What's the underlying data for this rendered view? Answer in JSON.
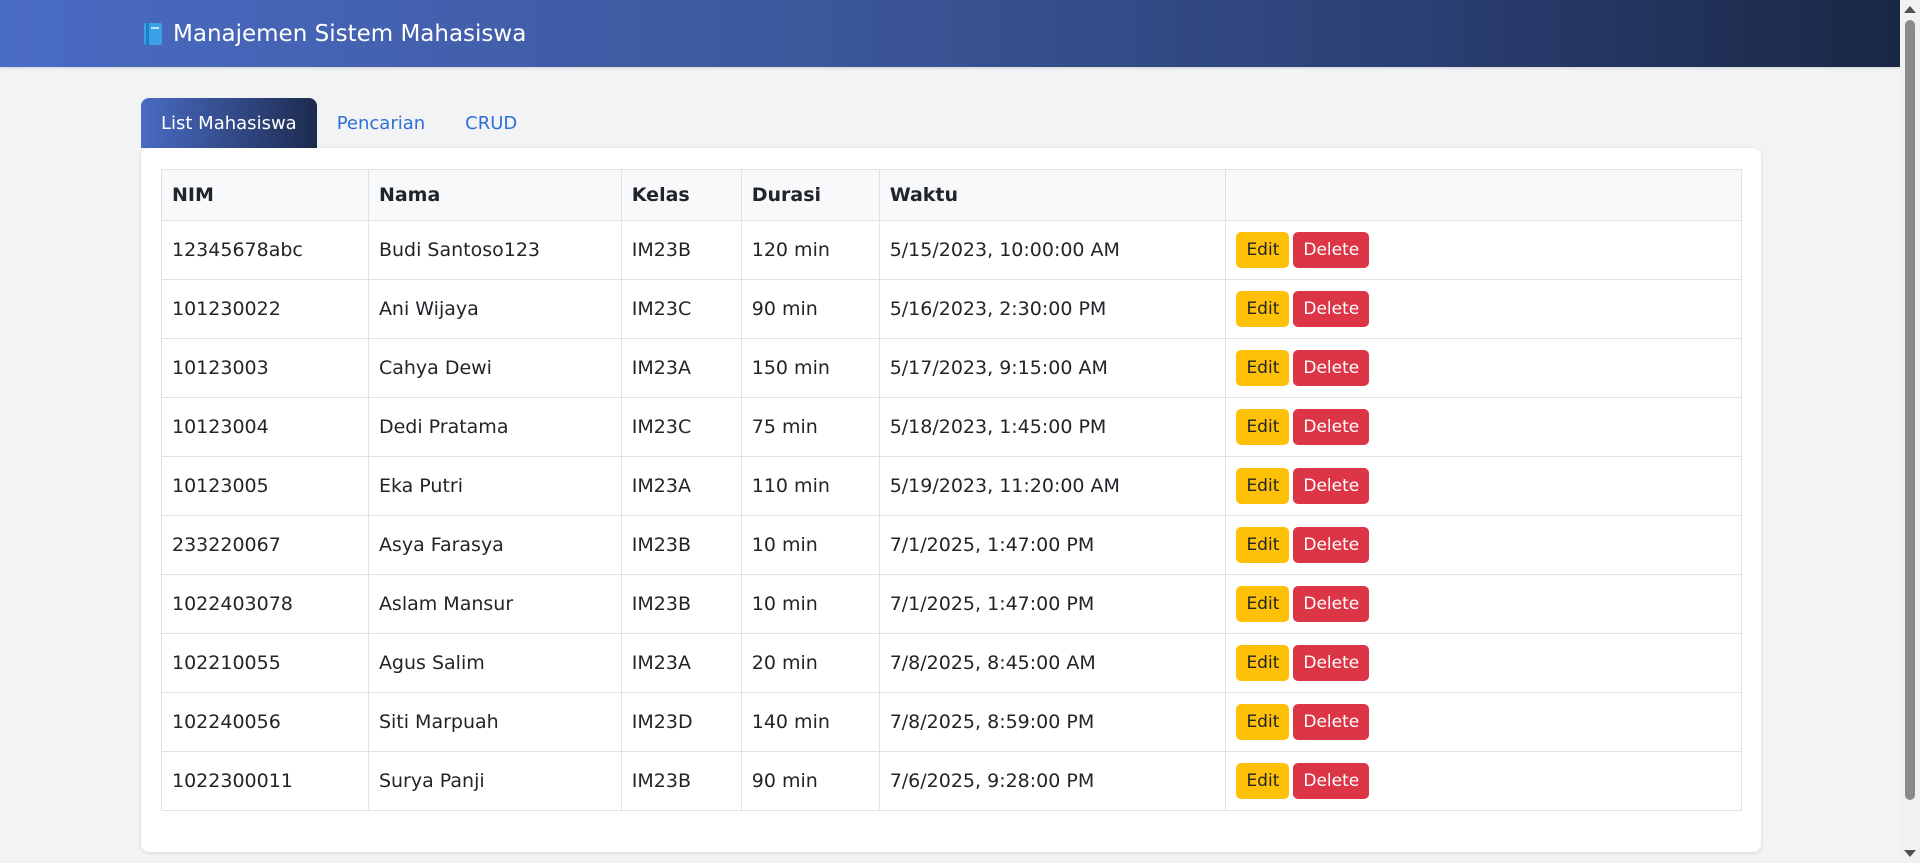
{
  "app": {
    "title": "Manajemen Sistem Mahasiswa",
    "icon": "book-icon"
  },
  "tabs": [
    {
      "label": "List Mahasiswa",
      "active": true
    },
    {
      "label": "Pencarian",
      "active": false
    },
    {
      "label": "CRUD",
      "active": false
    }
  ],
  "table": {
    "headers": [
      "NIM",
      "Nama",
      "Kelas",
      "Durasi",
      "Waktu",
      ""
    ],
    "rows": [
      {
        "nim": "12345678abc",
        "nama": "Budi Santoso123",
        "kelas": "IM23B",
        "durasi": "120 min",
        "waktu": "5/15/2023, 10:00:00 AM"
      },
      {
        "nim": "101230022",
        "nama": "Ani Wijaya",
        "kelas": "IM23C",
        "durasi": "90 min",
        "waktu": "5/16/2023, 2:30:00 PM"
      },
      {
        "nim": "10123003",
        "nama": "Cahya Dewi",
        "kelas": "IM23A",
        "durasi": "150 min",
        "waktu": "5/17/2023, 9:15:00 AM"
      },
      {
        "nim": "10123004",
        "nama": "Dedi Pratama",
        "kelas": "IM23C",
        "durasi": "75 min",
        "waktu": "5/18/2023, 1:45:00 PM"
      },
      {
        "nim": "10123005",
        "nama": "Eka Putri",
        "kelas": "IM23A",
        "durasi": "110 min",
        "waktu": "5/19/2023, 11:20:00 AM"
      },
      {
        "nim": "233220067",
        "nama": "Asya Farasya",
        "kelas": "IM23B",
        "durasi": "10 min",
        "waktu": "7/1/2025, 1:47:00 PM"
      },
      {
        "nim": "1022403078",
        "nama": "Aslam Mansur",
        "kelas": "IM23B",
        "durasi": "10 min",
        "waktu": "7/1/2025, 1:47:00 PM"
      },
      {
        "nim": "102210055",
        "nama": "Agus Salim",
        "kelas": "IM23A",
        "durasi": "20 min",
        "waktu": "7/8/2025, 8:45:00 AM"
      },
      {
        "nim": "102240056",
        "nama": "Siti Marpuah",
        "kelas": "IM23D",
        "durasi": "140 min",
        "waktu": "7/8/2025, 8:59:00 PM"
      },
      {
        "nim": "1022300011",
        "nama": "Surya Panji",
        "kelas": "IM23B",
        "durasi": "90 min",
        "waktu": "7/6/2025, 9:28:00 PM"
      }
    ],
    "actions": {
      "edit_label": "Edit",
      "delete_label": "Delete"
    }
  },
  "colors": {
    "header_gradient_start": "#4a6bc4",
    "header_gradient_end": "#1a2744",
    "edit_button": "#ffc107",
    "delete_button": "#dc3545",
    "tab_link": "#2f6fd6"
  }
}
